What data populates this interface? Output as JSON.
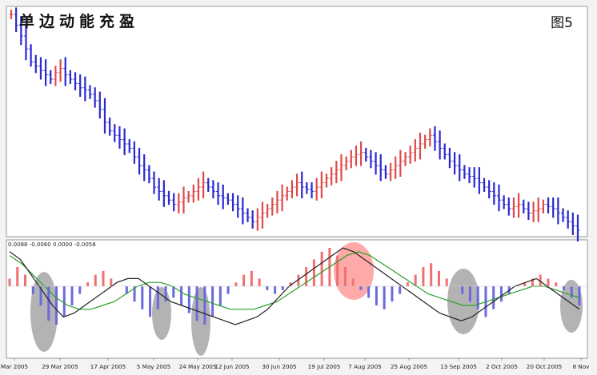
{
  "title": "单边动能充盈",
  "figure_label": "图5",
  "indicator_readout": "0.0088 -0.0060 0.0000 -0.0058",
  "colors": {
    "up_bar": "#e04a4a",
    "down_bar": "#2a2ad0",
    "hist_up": "#f07070",
    "hist_down": "#6a6ae0",
    "macd_line": "#222222",
    "signal_line": "#2aa02a",
    "highlight_gray": "#808080",
    "highlight_red": "#ff4040"
  },
  "chart_data": {
    "type": "bar",
    "price_panel": {
      "series": "OHLC bars",
      "ylim": [
        0,
        100
      ],
      "close_path_approx": [
        100,
        95,
        90,
        84,
        78,
        76,
        74,
        72,
        70,
        73,
        75,
        72,
        70,
        68,
        66,
        65,
        63,
        60,
        56,
        50,
        46,
        44,
        42,
        40,
        38,
        34,
        30,
        28,
        24,
        20,
        18,
        16,
        14,
        12,
        13,
        15,
        16,
        18,
        20,
        22,
        20,
        18,
        16,
        15,
        14,
        12,
        10,
        8,
        6,
        4,
        6,
        8,
        10,
        12,
        14,
        16,
        18,
        20,
        22,
        20,
        19,
        18,
        20,
        22,
        24,
        26,
        28,
        30,
        32,
        34,
        35,
        36,
        34,
        32,
        30,
        28,
        26,
        28,
        30,
        32,
        34,
        36,
        38,
        40,
        42,
        44,
        41,
        38,
        35,
        32,
        30,
        28,
        26,
        25,
        24,
        22,
        20,
        18,
        16,
        14,
        12,
        10,
        11,
        12,
        10,
        8,
        9,
        10,
        12,
        11,
        10,
        8,
        6,
        4,
        2,
        0
      ]
    },
    "indicator_panel": {
      "series": [
        {
          "values": [
            0.2,
            0.5,
            0.3,
            -0.2,
            -0.5,
            -0.9,
            -1.0,
            -0.8,
            -0.5,
            -0.2,
            0.1,
            0.3,
            0.4,
            0.2,
            0.0,
            -0.2,
            -0.4,
            -0.6,
            -0.8,
            -0.6,
            -0.4,
            -0.3,
            -0.5,
            -0.7,
            -0.9,
            -1.0,
            -0.8,
            -0.5,
            -0.2,
            0.1,
            0.3,
            0.4,
            0.2,
            -0.1,
            -0.2,
            -0.1,
            0.1,
            0.3,
            0.5,
            0.7,
            0.9,
            1.0,
            0.8,
            0.5,
            0.2,
            -0.1,
            -0.3,
            -0.5,
            -0.6,
            -0.4,
            -0.2,
            0.1,
            0.3,
            0.5,
            0.6,
            0.4,
            0.2,
            0.0,
            -0.2,
            -0.4,
            -0.6,
            -0.8,
            -0.6,
            -0.4,
            -0.2,
            0.0,
            0.1,
            0.2,
            0.3,
            0.2,
            0.1,
            -0.1,
            -0.3,
            -0.5
          ]
        },
        {
          "values": [
            0.9,
            0.7,
            0.3,
            -0.1,
            -0.5,
            -0.8,
            -0.7,
            -0.5,
            -0.3,
            -0.1,
            0.1,
            0.2,
            0.2,
            0.0,
            -0.2,
            -0.4,
            -0.5,
            -0.6,
            -0.7,
            -0.8,
            -0.9,
            -1.0,
            -0.9,
            -0.8,
            -0.6,
            -0.3,
            0.0,
            0.2,
            0.4,
            0.6,
            0.8,
            1.0,
            0.9,
            0.7,
            0.5,
            0.3,
            0.1,
            -0.1,
            -0.3,
            -0.5,
            -0.7,
            -0.8,
            -0.9,
            -0.8,
            -0.6,
            -0.4,
            -0.2,
            0.0,
            0.1,
            0.2,
            0.0,
            -0.2,
            -0.4,
            -0.6
          ]
        },
        {
          "values": [
            0.8,
            0.6,
            0.3,
            0.0,
            -0.3,
            -0.5,
            -0.6,
            -0.6,
            -0.5,
            -0.4,
            -0.2,
            0.0,
            0.1,
            0.1,
            0.0,
            -0.2,
            -0.3,
            -0.4,
            -0.5,
            -0.6,
            -0.6,
            -0.6,
            -0.5,
            -0.4,
            -0.2,
            0.0,
            0.2,
            0.4,
            0.6,
            0.8,
            0.9,
            0.8,
            0.6,
            0.4,
            0.2,
            0.0,
            -0.2,
            -0.3,
            -0.4,
            -0.5,
            -0.5,
            -0.4,
            -0.3,
            -0.2,
            -0.1,
            0.0,
            0.0,
            -0.1,
            -0.2,
            -0.3
          ]
        }
      ]
    },
    "x_tick_labels": [
      "Mar 2005",
      "29 Mar 2005",
      "17 Apr 2005",
      "5 May 2005",
      "24 May 2005",
      "12 Jun 2005",
      "30 Jun 2005",
      "19 Jul 2005",
      "7 Aug 2005",
      "25 Aug 2005",
      "13 Sep 2005",
      "2 Oct 2005",
      "20 Oct 2005",
      "8 Nov"
    ],
    "highlights": [
      {
        "shape": "ellipse",
        "color": "gray",
        "near_x_label": "29 Mar 2005"
      },
      {
        "shape": "ellipse",
        "color": "gray",
        "near_x_label": "5 May 2005"
      },
      {
        "shape": "ellipse",
        "color": "gray",
        "near_x_label": "24 May 2005"
      },
      {
        "shape": "ellipse",
        "color": "red",
        "near_x_label": "7 Aug 2005"
      },
      {
        "shape": "ellipse",
        "color": "gray",
        "near_x_label": "13 Sep 2005"
      },
      {
        "shape": "ellipse",
        "color": "gray",
        "near_x_label": "8 Nov"
      }
    ],
    "grid": false
  }
}
